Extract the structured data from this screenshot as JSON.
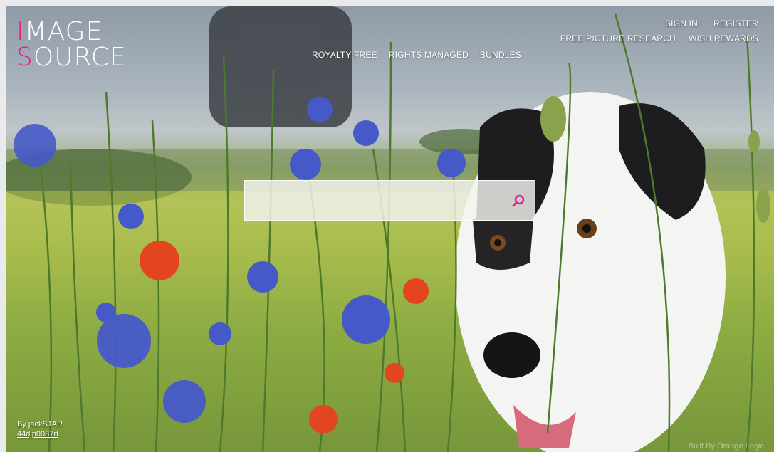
{
  "logo": {
    "line1_accent": "I",
    "line1_rest": "MAGE",
    "line2_accent": "S",
    "line2_rest": "OURCE"
  },
  "nav_top": {
    "sign_in": "SIGN IN",
    "register": "REGISTER"
  },
  "nav_sub": {
    "free_research": "FREE PICTURE RESEARCH",
    "wish_rewards": "WISH REWARDS"
  },
  "main_nav": {
    "royalty_free": "ROYALTY FREE",
    "rights_managed": "RIGHTS MANAGED",
    "bundles": "BUNDLES"
  },
  "search": {
    "placeholder": "",
    "value": "",
    "icon": "search-icon"
  },
  "credit": {
    "by_line": "By jackSTAR",
    "image_code": "44djp0087rf"
  },
  "footer": {
    "built_by": "Built By Orange Logic"
  },
  "colors": {
    "accent": "#e21d8c",
    "nav_text": "#ffffff"
  }
}
